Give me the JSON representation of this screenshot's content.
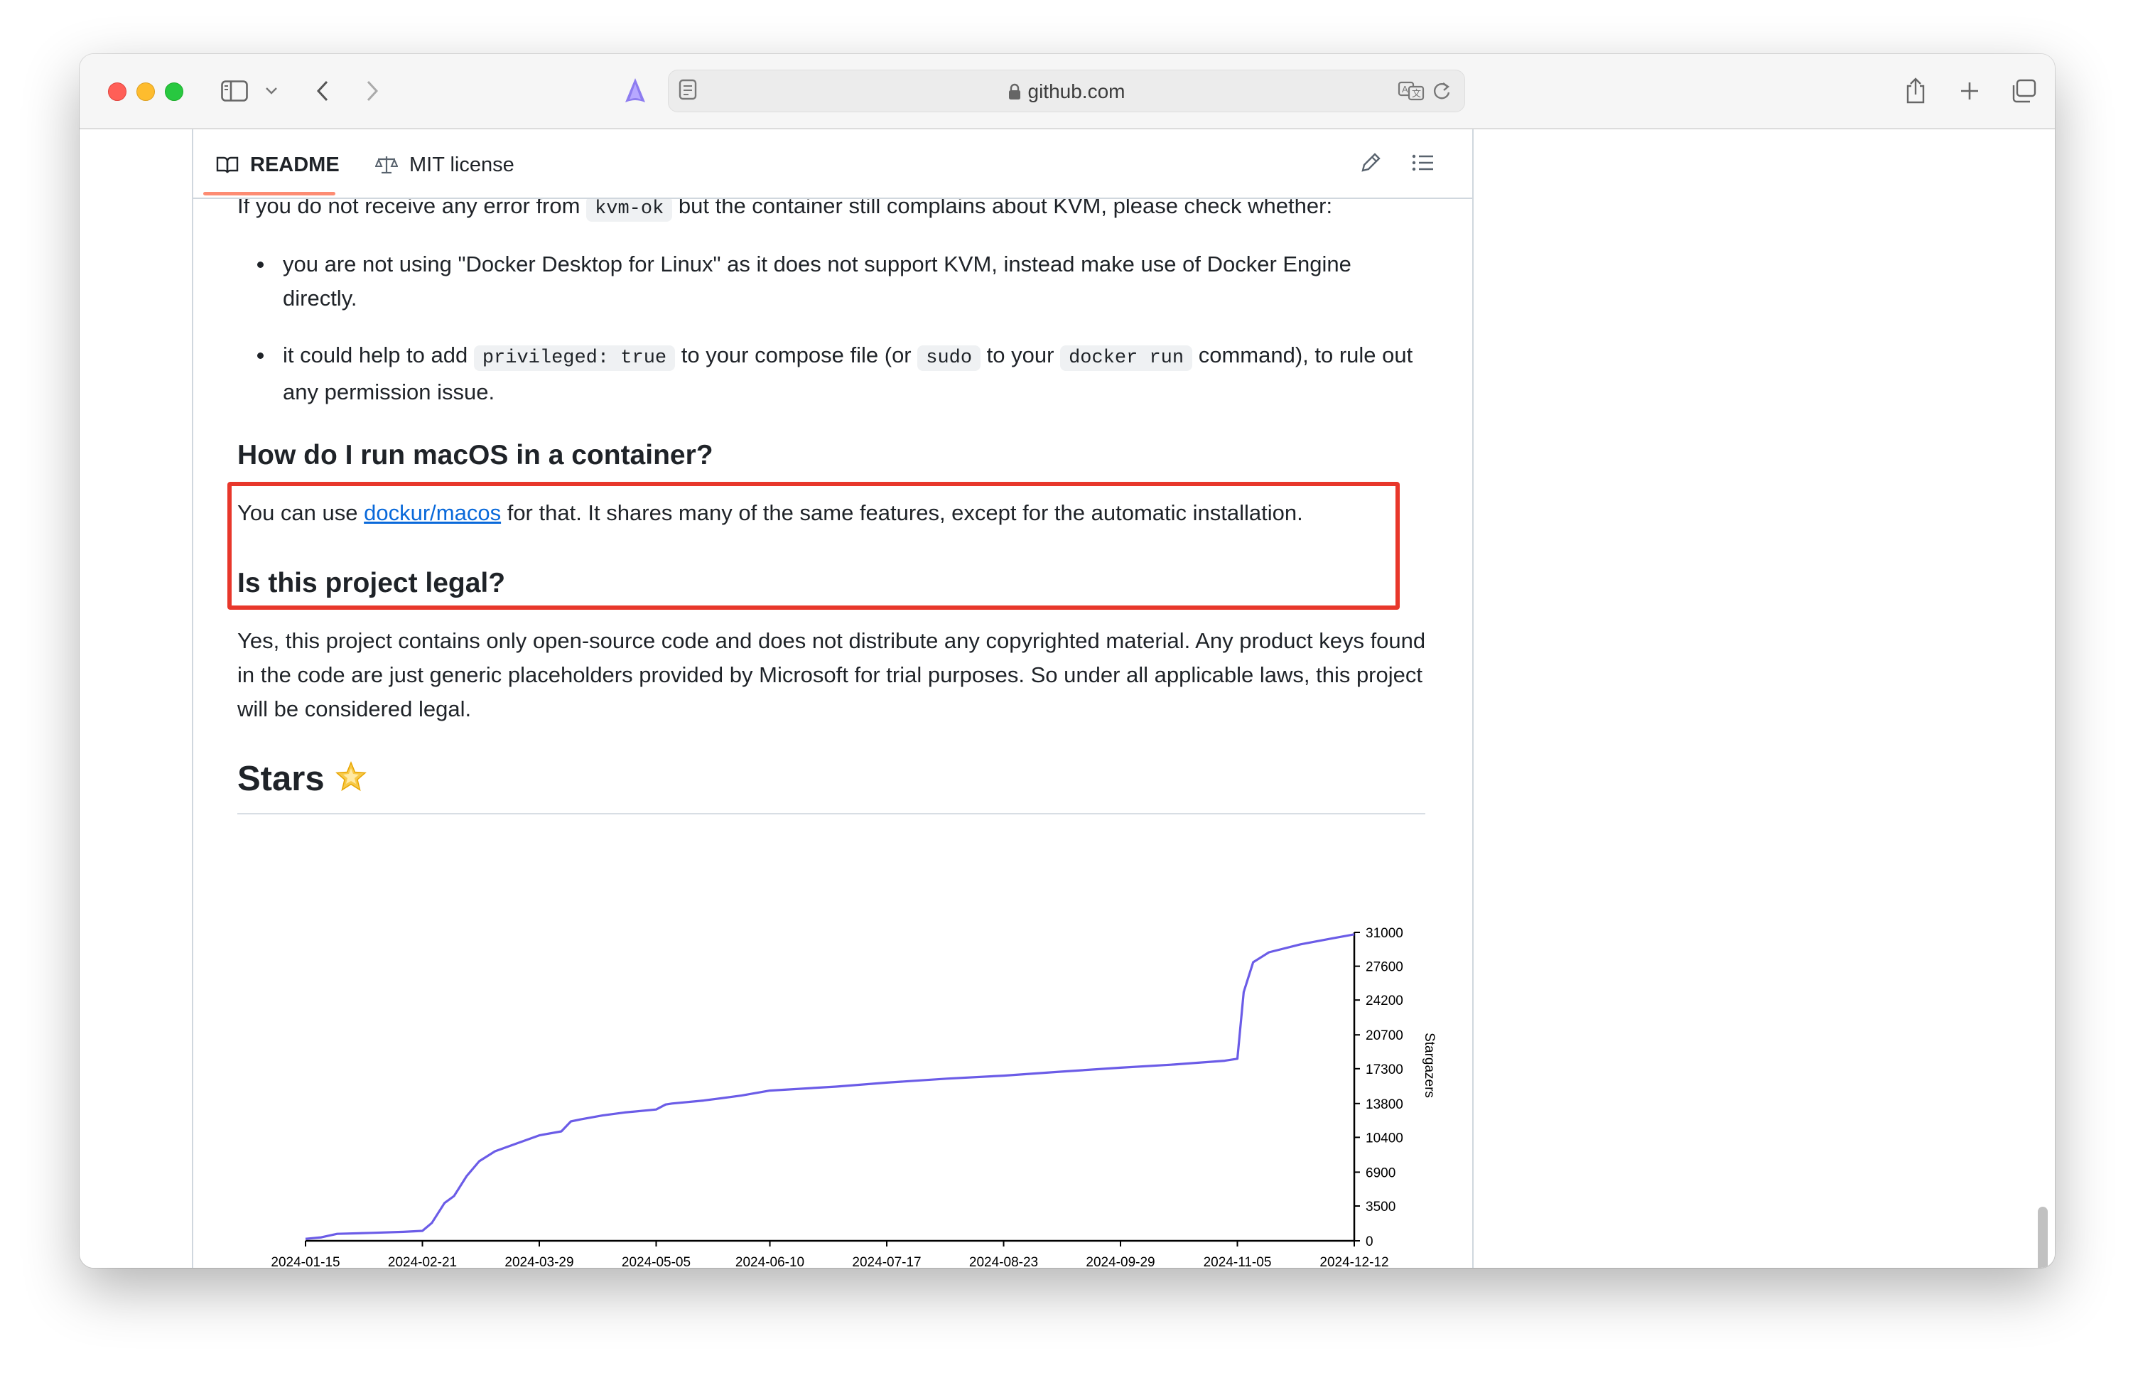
{
  "browser": {
    "address": "github.com"
  },
  "readme_tabs": [
    {
      "label": "README",
      "active": true,
      "icon": "book-icon"
    },
    {
      "label": "MIT license",
      "active": false,
      "icon": "scale-icon"
    }
  ],
  "article": {
    "intro_before": "If you do not receive any error from ",
    "intro_code": "kvm-ok",
    "intro_after": " but the container still complains about KVM, please check whether:",
    "bullet1": "you are not using \"Docker Desktop for Linux\" as it does not support KVM, instead make use of Docker Engine directly.",
    "bullet2_a": "it could help to add ",
    "bullet2_code1": "privileged: true",
    "bullet2_b": " to your compose file (or ",
    "bullet2_code2": "sudo",
    "bullet2_c": " to your ",
    "bullet2_code3": "docker run",
    "bullet2_d": " command), to rule out any permission issue.",
    "macos_heading": "How do I run macOS in a container?",
    "macos_a": "You can use ",
    "macos_link": "dockur/macos",
    "macos_b": " for that. It shares many of the same features, except for the automatic installation.",
    "legal_heading": "Is this project legal?",
    "legal_text": "Yes, this project contains only open-source code and does not distribute any copyrighted material. Any product keys found in the code are just generic placeholders provided by Microsoft for trial purposes. So under all applicable laws, this project will be considered legal.",
    "stars_heading": "Stars",
    "stars_emoji_icon": "glowing-star-icon"
  },
  "highlight_color": "#e8372b",
  "chart_data": {
    "type": "line",
    "ylabel": "Stargazers",
    "x_ticks": [
      "2024-01-15",
      "2024-02-21",
      "2024-03-29",
      "2024-05-05",
      "2024-06-10",
      "2024-07-17",
      "2024-08-23",
      "2024-09-29",
      "2024-11-05",
      "2024-12-12"
    ],
    "y_ticks": [
      0,
      3500,
      6900,
      10400,
      13800,
      17300,
      20700,
      24200,
      27600,
      31000
    ],
    "ylim": [
      0,
      31000
    ],
    "xlim": [
      "2024-01-15",
      "2024-12-12"
    ],
    "line_color": "#6b5ce7",
    "series": [
      {
        "x": [
          "2024-01-15",
          "2024-01-20",
          "2024-01-25",
          "2024-02-05",
          "2024-02-15",
          "2024-02-21",
          "2024-02-24",
          "2024-02-28",
          "2024-03-02",
          "2024-03-06",
          "2024-03-10",
          "2024-03-15",
          "2024-03-22",
          "2024-03-29",
          "2024-04-05",
          "2024-04-08",
          "2024-04-11",
          "2024-04-18",
          "2024-04-25",
          "2024-05-05",
          "2024-05-08",
          "2024-05-10",
          "2024-05-20",
          "2024-06-01",
          "2024-06-10",
          "2024-07-01",
          "2024-07-17",
          "2024-08-05",
          "2024-08-23",
          "2024-09-10",
          "2024-09-29",
          "2024-10-15",
          "2024-11-01",
          "2024-11-05",
          "2024-11-07",
          "2024-11-10",
          "2024-11-15",
          "2024-11-25",
          "2024-12-05",
          "2024-12-12"
        ],
        "y": [
          200,
          350,
          700,
          800,
          900,
          1000,
          1800,
          3800,
          4500,
          6500,
          8000,
          9000,
          9800,
          10600,
          11000,
          12000,
          12200,
          12600,
          12900,
          13200,
          13700,
          13800,
          14100,
          14600,
          15100,
          15500,
          15900,
          16300,
          16600,
          17000,
          17400,
          17700,
          18100,
          18300,
          25000,
          28000,
          29000,
          29800,
          30400,
          30800
        ]
      }
    ]
  }
}
